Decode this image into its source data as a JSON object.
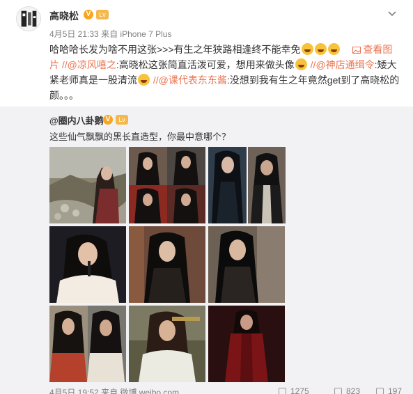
{
  "post": {
    "author": "高晓松",
    "verified_badge": "V",
    "level_badge": "Lv",
    "time": "4月5日 21:33",
    "source_prefix": "来自",
    "source": "iPhone 7 Plus",
    "text_1": "哈哈哈长发为啥不用这张>>>有生之年狭路相逢终不能幸免",
    "view_image_link": "查看图片",
    "mention_1": "//@凉风嘻之",
    "text_2": ":高晓松这张简直活泼可爱，想用来做头像",
    "mention_2": "//@神店通缉令",
    "text_3": ":矮大紧老师真是一股清流",
    "mention_3": "//@课代表东东酱",
    "text_4": ":没想到我有生之年竟然get到了高晓松的颜。。。"
  },
  "repost": {
    "author": "@圈内八卦鹅",
    "verified_badge": "V",
    "level_badge": "Lv",
    "text": "这些仙气飘飘的黑长直造型，你最中意哪个？",
    "footer_time": "4月5日 19:52",
    "footer_source": "来自 微博 weibo.com",
    "reposts": "1275",
    "comments": "823",
    "likes": "197"
  },
  "icons": {
    "menu": "chevron-down-icon",
    "view_image": "image-icon"
  },
  "colors": {
    "link": "#eb7350",
    "repost_bg": "#f2f2f5",
    "meta": "#808080"
  }
}
